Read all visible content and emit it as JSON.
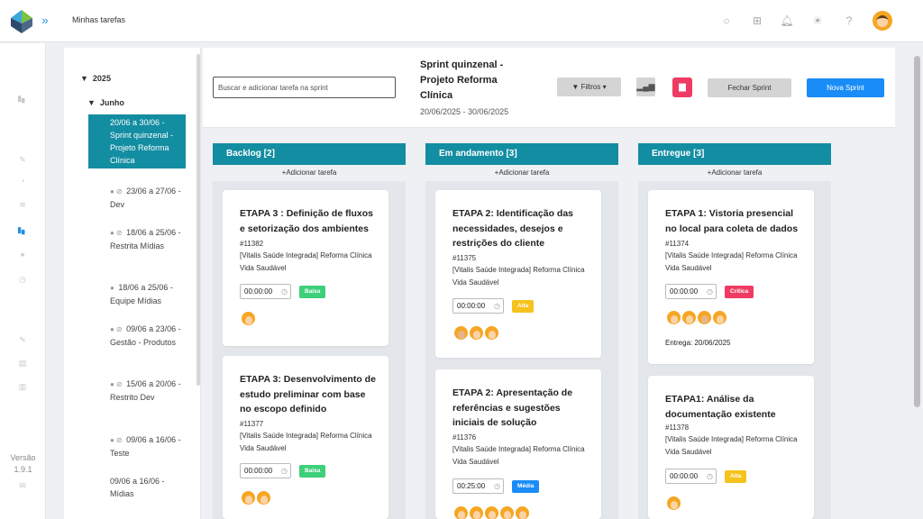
{
  "header": {
    "title": "Minhas tarefas",
    "icons": [
      "search-icon",
      "plus-icon",
      "bell-icon",
      "sun-icon",
      "help-icon"
    ]
  },
  "sidebar": {
    "version_label": "Versão",
    "version_number": "1.9.1"
  },
  "tree": {
    "year": "2025",
    "month": "Junho",
    "items": [
      {
        "label": "20/06 a 30/06 - Sprint quinzenal - Projeto Reforma Clínica",
        "selected": true
      },
      {
        "label": "23/06 a 27/06 - Dev",
        "hidden_icons": true
      },
      {
        "label": "18/06 a 25/06 - Restrita Mídias",
        "hidden_icons": true
      },
      {
        "label": "18/06 a 25/06 - Equipe Mídias",
        "hidden_icons": true
      },
      {
        "label": "09/06 a 23/06 - Gestão - Produtos",
        "hidden_icons": true
      },
      {
        "label": "15/06 a 20/06 - Restrito Dev",
        "hidden_icons": true
      },
      {
        "label": "09/06 a 16/06 - Teste",
        "hidden_icons": true
      },
      {
        "label": "09/06 a 16/06 - Mídias",
        "hidden_icons": false
      }
    ]
  },
  "board_header": {
    "search_placeholder": "Buscar e adicionar tarefa na sprint",
    "sprint_title": "Sprint quinzenal - Projeto Reforma Clínica",
    "sprint_dates": "20/06/2025 - 30/06/2025",
    "filter_label": "Filtros",
    "close_sprint_label": "Fechar Sprint",
    "new_sprint_label": "Nova Sprint"
  },
  "add_task_label": "Adicionar tarefa",
  "columns": [
    {
      "title": "Backlog [2]",
      "cards": [
        {
          "title": "ETAPA 3 : Definição de fluxos e setorização dos ambientes",
          "id": "#11382",
          "project": "[Vitalis Saúde Integrada] Reforma Clínica Vida Saudável",
          "time": "00:00:00",
          "priority": "Baixa",
          "priority_color": "#3ecf7a",
          "avatars": 1
        },
        {
          "title": "ETAPA 3: Desenvolvimento de estudo preliminar com base no escopo definido",
          "id": "#11377",
          "project": "[Vitalis Saúde Integrada] Reforma Clínica Vida Saudável",
          "time": "00:00:00",
          "priority": "Baixa",
          "priority_color": "#3ecf7a",
          "avatars": 2
        }
      ]
    },
    {
      "title": "Em andamento [3]",
      "cards": [
        {
          "title": "ETAPA 2: Identificação das necessidades, desejos e restrições do cliente",
          "id": "#11375",
          "project": "[Vitalis Saúde Integrada] Reforma Clínica Vida Saudável",
          "time": "00:00:00",
          "priority": "Alta",
          "priority_color": "#f6c21c",
          "avatars": 3
        },
        {
          "title": "ETAPA 2: Apresentação de referências e sugestões iniciais de solução",
          "id": "#11376",
          "project": "[Vitalis Saúde Integrada] Reforma Clínica Vida Saudável",
          "time": "00:25:00",
          "priority": "Média",
          "priority_color": "#1a8cf7",
          "avatars": 5
        }
      ]
    },
    {
      "title": "Entregue [3]",
      "cards": [
        {
          "title": "ETAPA 1: Vistoria presencial no local para coleta de dados",
          "id": "#11374",
          "project": "[Vitalis Saúde Integrada] Reforma Clínica Vida Saudável",
          "time": "00:00:00",
          "priority": "Crítica",
          "priority_color": "#ef3b63",
          "avatars": 4,
          "delivery": "Entrega: 20/06/2025"
        },
        {
          "title": "ETAPA1: Análise da documentação existente",
          "id": "#11378",
          "project": "[Vitalis Saúde Integrada] Reforma Clínica Vida Saudável",
          "time": "00:00:00",
          "priority": "Alta",
          "priority_color": "#f6c21c",
          "avatars": 1
        }
      ]
    }
  ]
}
